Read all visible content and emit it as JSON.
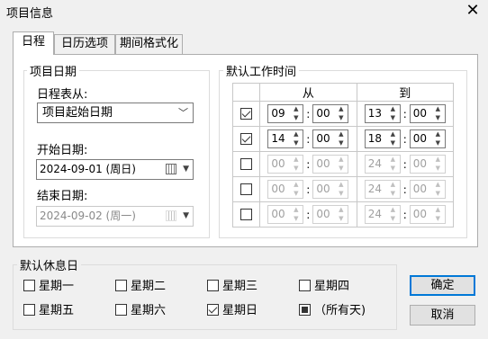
{
  "window": {
    "title": "项目信息"
  },
  "tabs": [
    {
      "label": "日程",
      "active": true
    },
    {
      "label": "日历选项",
      "active": false
    },
    {
      "label": "期间格式化",
      "active": false
    }
  ],
  "project_dates": {
    "group_label": "项目日期",
    "schedule_from_label": "日程表从:",
    "schedule_from_value": "项目起始日期",
    "start_label": "开始日期:",
    "start_value": "2024-09-01 (周日)",
    "end_label": "结束日期:",
    "end_value": "2024-09-02 (周一)"
  },
  "work_time": {
    "group_label": "默认工作时间",
    "from_header": "从",
    "to_header": "到",
    "rows": [
      {
        "checked": true,
        "from_h": "09",
        "from_m": "00",
        "to_h": "13",
        "to_m": "00"
      },
      {
        "checked": true,
        "from_h": "14",
        "from_m": "00",
        "to_h": "18",
        "to_m": "00"
      },
      {
        "checked": false,
        "from_h": "00",
        "from_m": "00",
        "to_h": "24",
        "to_m": "00"
      },
      {
        "checked": false,
        "from_h": "00",
        "from_m": "00",
        "to_h": "24",
        "to_m": "00"
      },
      {
        "checked": false,
        "from_h": "00",
        "from_m": "00",
        "to_h": "24",
        "to_m": "00"
      }
    ]
  },
  "rest_days": {
    "group_label": "默认休息日",
    "days": [
      {
        "label": "星期一",
        "checked": false
      },
      {
        "label": "星期二",
        "checked": false
      },
      {
        "label": "星期三",
        "checked": false
      },
      {
        "label": "星期四",
        "checked": false
      },
      {
        "label": "星期五",
        "checked": false
      },
      {
        "label": "星期六",
        "checked": false
      },
      {
        "label": "星期日",
        "checked": true
      },
      {
        "label": "（所有天)",
        "checked": "partial"
      }
    ]
  },
  "buttons": {
    "ok": "确定",
    "cancel": "取消"
  },
  "colors": {
    "default_button_border": "#0078d7",
    "panel_border": "#adadad"
  }
}
